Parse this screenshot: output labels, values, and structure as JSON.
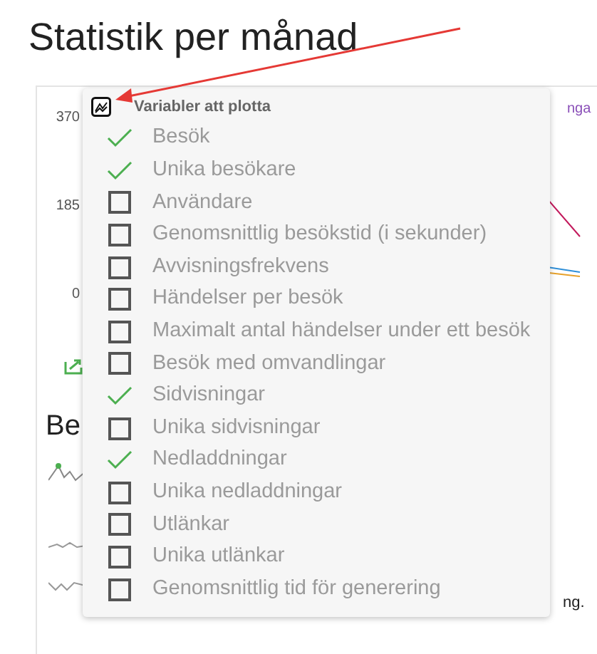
{
  "title": "Statistik per månad",
  "background": {
    "axis_labels": [
      "370",
      "185",
      "0"
    ],
    "legend_fragment": "nga",
    "heading_fragment": "Be",
    "table_fragment": "ng."
  },
  "popup": {
    "title": "Variabler att plotta",
    "items": [
      {
        "label": "Besök",
        "checked": true
      },
      {
        "label": "Unika besökare",
        "checked": true
      },
      {
        "label": "Användare",
        "checked": false
      },
      {
        "label": "Genomsnittlig besökstid (i sekunder)",
        "checked": false
      },
      {
        "label": "Avvisningsfrekvens",
        "checked": false
      },
      {
        "label": "Händelser per besök",
        "checked": false
      },
      {
        "label": "Maximalt antal händelser under ett besök",
        "checked": false
      },
      {
        "label": "Besök med omvandlingar",
        "checked": false
      },
      {
        "label": "Sidvisningar",
        "checked": true
      },
      {
        "label": "Unika sidvisningar",
        "checked": false
      },
      {
        "label": "Nedladdningar",
        "checked": true
      },
      {
        "label": "Unika nedladdningar",
        "checked": false
      },
      {
        "label": "Utlänkar",
        "checked": false
      },
      {
        "label": "Unika utlänkar",
        "checked": false
      },
      {
        "label": "Genomsnittlig tid för generering",
        "checked": false
      }
    ]
  }
}
